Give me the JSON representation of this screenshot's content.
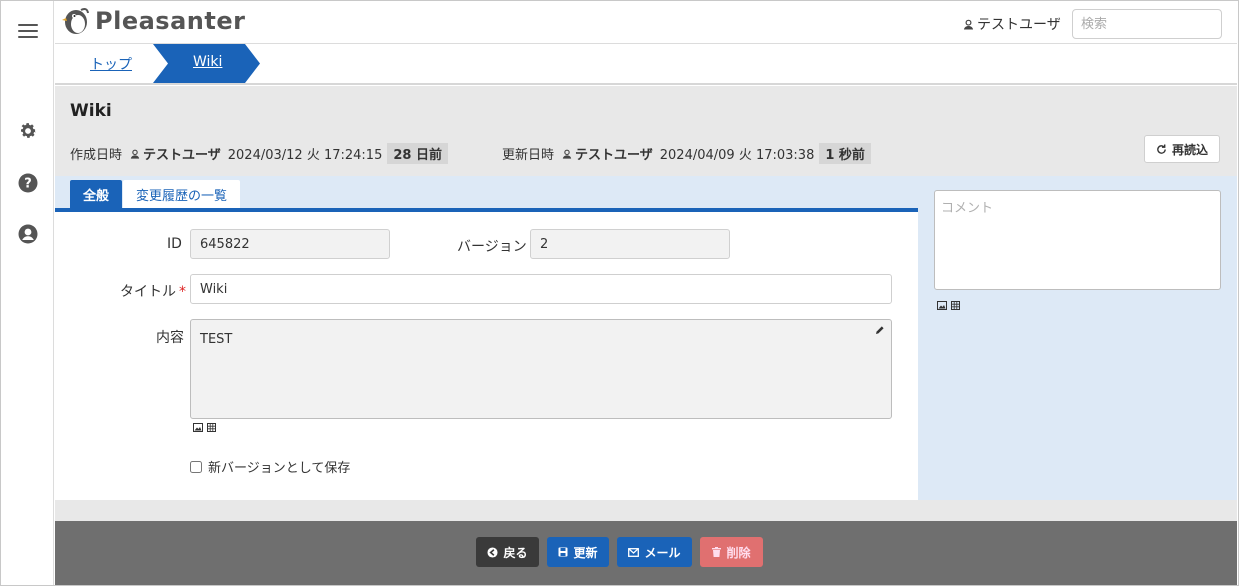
{
  "app": {
    "name": "Pleasanter"
  },
  "header": {
    "user": "テストユーザ",
    "search_placeholder": "検索"
  },
  "breadcrumb": [
    {
      "label": "トップ"
    },
    {
      "label": "Wiki"
    }
  ],
  "page": {
    "title": "Wiki",
    "created_label": "作成日時",
    "created_user": "テストユーザ",
    "created_at": "2024/03/12 火 17:24:15",
    "created_relative": "28 日前",
    "updated_label": "更新日時",
    "updated_user": "テストユーザ",
    "updated_at": "2024/04/09 火 17:03:38",
    "updated_relative": "1 秒前",
    "reload_label": "再読込"
  },
  "tabs": [
    {
      "label": "全般",
      "active": true
    },
    {
      "label": "変更履歴の一覧",
      "active": false
    }
  ],
  "form": {
    "id_label": "ID",
    "id_value": "645822",
    "version_label": "バージョン",
    "version_value": "2",
    "title_label": "タイトル",
    "title_required_mark": "*",
    "title_value": "Wiki",
    "body_label": "内容",
    "body_value": "TEST",
    "new_version_label": "新バージョンとして保存",
    "new_version_checked": false
  },
  "comment": {
    "placeholder": "コメント"
  },
  "footer": {
    "back_label": "戻る",
    "update_label": "更新",
    "mail_label": "メール",
    "delete_label": "削除"
  },
  "colors": {
    "accent": "#1a63b8",
    "content_bg": "#dde9f6",
    "footer_bg": "#6f6f6f",
    "delete": "#e07070"
  }
}
